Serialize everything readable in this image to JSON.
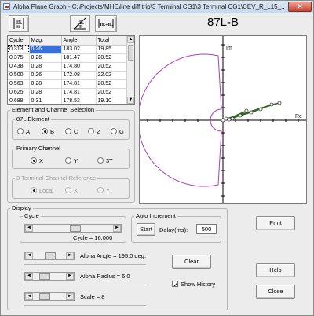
{
  "window": {
    "title": "Alpha Plane Graph - C:\\Projects\\MHE\\line diff trip\\3 Terminal CG1\\3 Terminal CG1\\CEV_R_L15_...",
    "close_glyph": "✕"
  },
  "toolbar": {
    "icons": [
      "ratio-magnitude-icon",
      "ratio-angle-icon",
      "sum-magnitude-icon"
    ]
  },
  "grid": {
    "columns": [
      "Cycle",
      "Mag.",
      "Angle",
      "Total"
    ],
    "rows": [
      [
        "0.313",
        "0.26",
        "183.02",
        "19.85"
      ],
      [
        "0.375",
        "0.26",
        "181.47",
        "20.52"
      ],
      [
        "0.438",
        "0.28",
        "174.80",
        "20.52"
      ],
      [
        "0.500",
        "0.26",
        "172.08",
        "22.02"
      ],
      [
        "0.563",
        "0.28",
        "174.81",
        "20.52"
      ],
      [
        "0.625",
        "0.28",
        "174.81",
        "20.52"
      ],
      [
        "0.688",
        "0.31",
        "178.53",
        "19.10"
      ]
    ]
  },
  "element_selection": {
    "label": "Element and Channel Selection",
    "element": {
      "label": "87L Element",
      "options": [
        "A",
        "B",
        "C",
        "2",
        "G"
      ],
      "selected": "B"
    },
    "primary_channel": {
      "label": "Primary Channel",
      "options": [
        "X",
        "Y",
        "3T"
      ],
      "selected": "X"
    },
    "terminal3": {
      "label": "3 Terminal Channel Reference",
      "options": [
        "Local",
        "X",
        "Y"
      ],
      "selected": "Local"
    }
  },
  "plot": {
    "title": "87L-B",
    "axis_im": "Im",
    "axis_re": "Re",
    "restraint_color": "#b03cb8",
    "trajectory_color": "#2e6a1e"
  },
  "display": {
    "label": "Display",
    "cycle_label": "Cycle",
    "cycle_value_text": "Cycle = 16.000",
    "cycle_fraction": 0.53,
    "auto_increment": {
      "label": "Auto Increment",
      "start_label": "Start",
      "delay_label": "Delay(ms):",
      "delay_value": "500"
    },
    "alpha_angle_text": "Alpha Angle = 195.0 deg.",
    "alpha_angle_fraction": 0.54,
    "alpha_radius_text": "Alpha Radius = 6.0",
    "alpha_radius_fraction": 0.28,
    "scale_text": "Scale = 8",
    "scale_fraction": 0.28,
    "clear_label": "Clear",
    "show_history_label": "Show History",
    "show_history_checked": true
  },
  "buttons": {
    "print": "Print",
    "help": "Help",
    "close": "Close"
  }
}
